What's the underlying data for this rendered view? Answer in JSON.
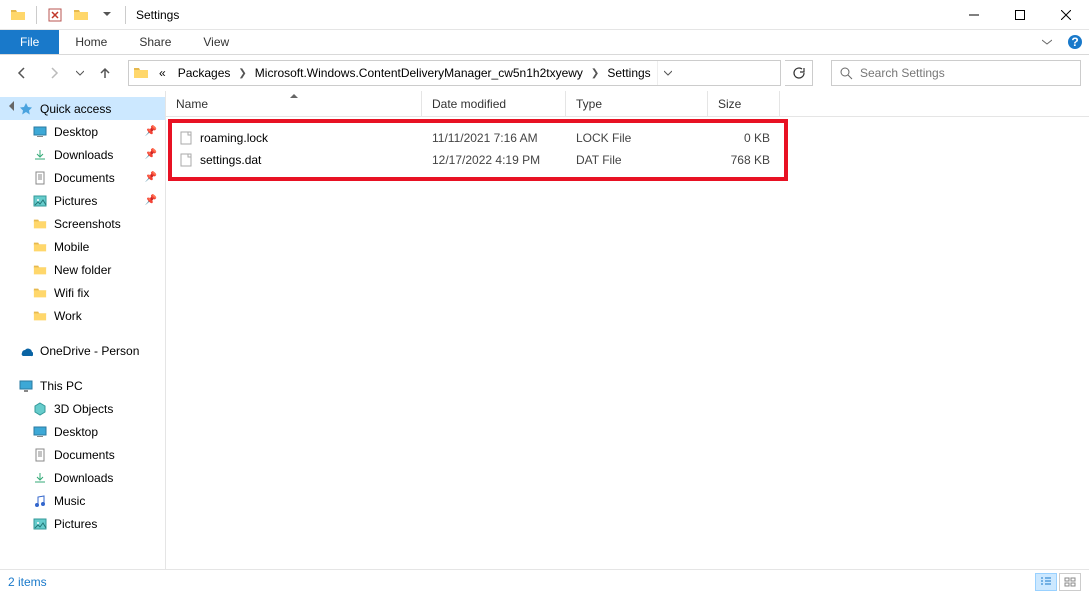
{
  "window": {
    "title": "Settings"
  },
  "ribbon": {
    "file": "File",
    "tabs": [
      "Home",
      "Share",
      "View"
    ]
  },
  "breadcrumbs": {
    "prefix": "«",
    "items": [
      "Packages",
      "Microsoft.Windows.ContentDeliveryManager_cw5n1h2txyewy",
      "Settings"
    ]
  },
  "search": {
    "placeholder": "Search Settings"
  },
  "columns": {
    "name": "Name",
    "date": "Date modified",
    "type": "Type",
    "size": "Size"
  },
  "files": [
    {
      "name": "roaming.lock",
      "date": "11/11/2021 7:16 AM",
      "type": "LOCK File",
      "size": "0 KB"
    },
    {
      "name": "settings.dat",
      "date": "12/17/2022 4:19 PM",
      "type": "DAT File",
      "size": "768 KB"
    }
  ],
  "sidebar": {
    "quick_access": {
      "label": "Quick access",
      "items": [
        {
          "label": "Desktop",
          "pinned": true
        },
        {
          "label": "Downloads",
          "pinned": true
        },
        {
          "label": "Documents",
          "pinned": true
        },
        {
          "label": "Pictures",
          "pinned": true
        },
        {
          "label": "Screenshots",
          "pinned": false
        },
        {
          "label": "Mobile",
          "pinned": false
        },
        {
          "label": "New folder",
          "pinned": false
        },
        {
          "label": "Wifi fix",
          "pinned": false
        },
        {
          "label": "Work",
          "pinned": false
        }
      ]
    },
    "onedrive": {
      "label": "OneDrive - Person"
    },
    "this_pc": {
      "label": "This PC",
      "items": [
        {
          "label": "3D Objects"
        },
        {
          "label": "Desktop"
        },
        {
          "label": "Documents"
        },
        {
          "label": "Downloads"
        },
        {
          "label": "Music"
        },
        {
          "label": "Pictures"
        }
      ]
    }
  },
  "status": {
    "text": "2 items"
  }
}
